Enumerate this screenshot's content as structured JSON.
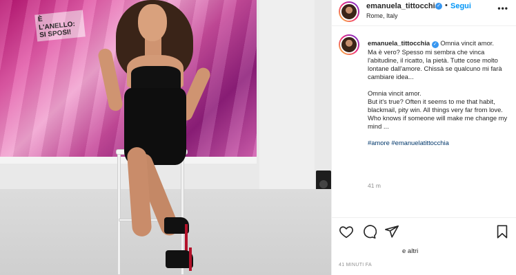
{
  "post": {
    "username": "emanuela_tittocchia",
    "follow_label": "Segui",
    "separator": "•",
    "location": "Rome, Italy",
    "more_icon": "more-icon",
    "background_text": "È L'ANELLO: SI SPOSI!"
  },
  "caption": {
    "username": "emanuela_tittocchia",
    "line_title": "Omnia vincit amor.",
    "paragraph_it": "Ma è vero? Spesso mi sembra che vinca l'abitudine, il ricatto, la pietà. Tutte cose molto lontane dall'amore. Chissà se qualcuno mi farà cambiare idea...",
    "line_title_2": "Omnia vincit amor.",
    "paragraph_en": "But it's true? Often it seems to me that habit, blackmail, pity win. All things very far from love. Who knows if someone will make me change my mind ...",
    "hashtags": "#amore #emanuelatittocchia",
    "time_ago": "41 m"
  },
  "actions": {
    "icons": [
      "heart-icon",
      "comment-icon",
      "share-icon",
      "bookmark-icon"
    ]
  },
  "footer": {
    "likes_suffix": "e altri",
    "date": "41 MINUTI FA"
  },
  "colors": {
    "accent": "#0095f6",
    "hashtag": "#00376b",
    "verified": "#3897f0",
    "muted": "#8e8e8e"
  }
}
